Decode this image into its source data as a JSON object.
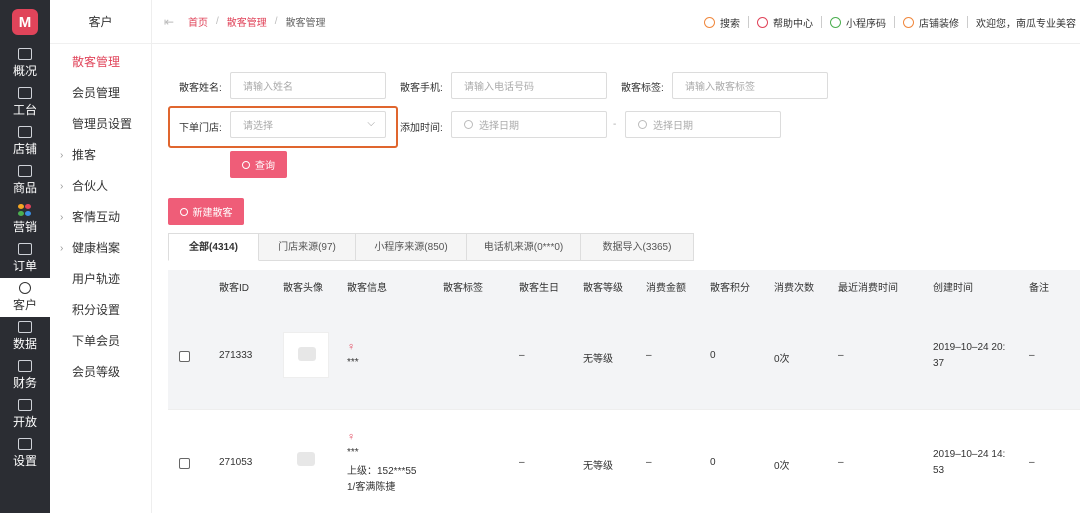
{
  "rail": {
    "logo": "M",
    "items": [
      {
        "label": "概况",
        "icon": "monitor-icon"
      },
      {
        "label": "工台",
        "icon": "desk-icon"
      },
      {
        "label": "店铺",
        "icon": "store-icon"
      },
      {
        "label": "商品",
        "icon": "bag-icon"
      },
      {
        "label": "营销",
        "icon": "palette-icon"
      },
      {
        "label": "订单",
        "icon": "clipboard-icon"
      },
      {
        "label": "客户",
        "icon": "user-icon",
        "active": true
      },
      {
        "label": "数据",
        "icon": "chart-icon"
      },
      {
        "label": "财务",
        "icon": "finance-icon"
      },
      {
        "label": "开放",
        "icon": "code-icon"
      },
      {
        "label": "设置",
        "icon": "gear-icon"
      }
    ]
  },
  "subnav": {
    "title": "客户",
    "items": [
      {
        "label": "散客管理",
        "active": true,
        "caret": ""
      },
      {
        "label": "会员管理",
        "caret": ""
      },
      {
        "label": "管理员设置",
        "caret": ""
      },
      {
        "label": "推客",
        "caret": "›"
      },
      {
        "label": "合伙人",
        "caret": "›"
      },
      {
        "label": "客情互动",
        "caret": "›"
      },
      {
        "label": "健康档案",
        "caret": "›"
      },
      {
        "label": "用户轨迹",
        "caret": ""
      },
      {
        "label": "积分设置",
        "caret": ""
      },
      {
        "label": "下单会员",
        "caret": ""
      },
      {
        "label": "会员等级",
        "caret": ""
      }
    ]
  },
  "topbar": {
    "back_icon": "⇤",
    "breadcrumb": [
      "首页",
      "散客管理",
      "散客管理"
    ],
    "breadcrumb_sep": "/",
    "actions": [
      {
        "label": "搜索",
        "icon": "search-icon",
        "color": "#f0883e"
      },
      {
        "label": "帮助中心",
        "icon": "help-icon",
        "color": "#e0445a"
      },
      {
        "label": "小程序码",
        "icon": "miniprogram-icon",
        "color": "#4caf50"
      },
      {
        "label": "店铺装修",
        "icon": "decorate-icon",
        "color": "#f0883e"
      }
    ],
    "welcome": "欢迎您，南瓜专业美容"
  },
  "filters": {
    "name_label": "散客姓名:",
    "name_placeholder": "请输入姓名",
    "phone_label": "散客手机:",
    "phone_placeholder": "请输入电话号码",
    "tag_label": "散客标签:",
    "tag_placeholder": "请输入散客标签",
    "store_label": "下单门店:",
    "store_placeholder": "请选择",
    "date_label": "添加时间:",
    "date_start_placeholder": "选择日期",
    "date_end_placeholder": "选择日期",
    "date_sep": "-",
    "query_button": "查询"
  },
  "new_button": "新建散客",
  "tabs": [
    "全部(4314)",
    "门店来源(97)",
    "小程序来源(850)",
    "电话机来源(0***0)",
    "数据导入(3365)"
  ],
  "table": {
    "columns": [
      "散客ID",
      "散客头像",
      "散客信息",
      "散客标签",
      "散客生日",
      "散客等级",
      "消费金额",
      "散客积分",
      "消费次数",
      "最近消费时间",
      "创建时间",
      "备注"
    ],
    "rows": [
      {
        "id": "271333",
        "gender": "♀",
        "info1": "***",
        "info2": "",
        "info3": "",
        "birthday": "–",
        "level": "无等级",
        "amount": "–",
        "points": "0",
        "count": "0次",
        "last": "–",
        "created1": "2019–10–24 20:",
        "created2": "37",
        "note": "–"
      },
      {
        "id": "271053",
        "gender": "♀",
        "info1": "***",
        "info2": "上级：152***55",
        "info3": "1/客满陈捷",
        "birthday": "–",
        "level": "无等级",
        "amount": "–",
        "points": "0",
        "count": "0次",
        "last": "–",
        "created1": "2019–10–24 14:",
        "created2": "53",
        "note": "–"
      }
    ]
  }
}
